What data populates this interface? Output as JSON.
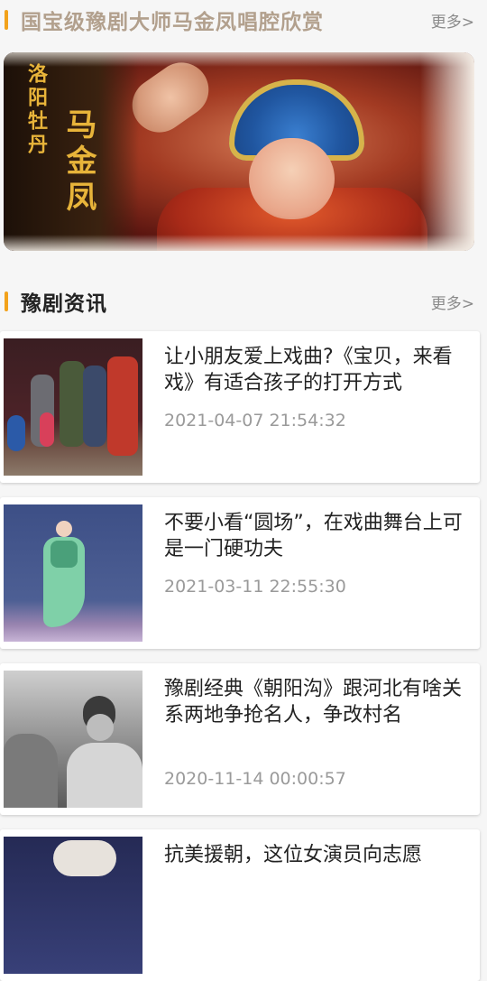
{
  "section_master": {
    "title": "国宝级豫剧大师马金凤唱腔欣赏",
    "more": "更多>"
  },
  "banner": {
    "poem": "洛阳牡丹",
    "name": "马金凤"
  },
  "section_news": {
    "title": "豫剧资讯",
    "more": "更多>"
  },
  "news": [
    {
      "title": "让小朋友爱上戏曲?《宝贝，来看戏》有适合孩子的打开方式",
      "time": "2021-04-07 21:54:32"
    },
    {
      "title": "不要小看“圆场”，在戏曲舞台上可是一门硬功夫",
      "time": "2021-03-11 22:55:30"
    },
    {
      "title": "豫剧经典《朝阳沟》跟河北有啥关系两地争抢名人，争改村名",
      "time": "2020-11-14 00:00:57"
    },
    {
      "title": "抗美援朝，这位女演员向志愿",
      "time": ""
    }
  ],
  "colors": {
    "accent": "#f2a21b",
    "section_title_muted": "#b2a08d",
    "time_text": "#9a9a9a"
  }
}
